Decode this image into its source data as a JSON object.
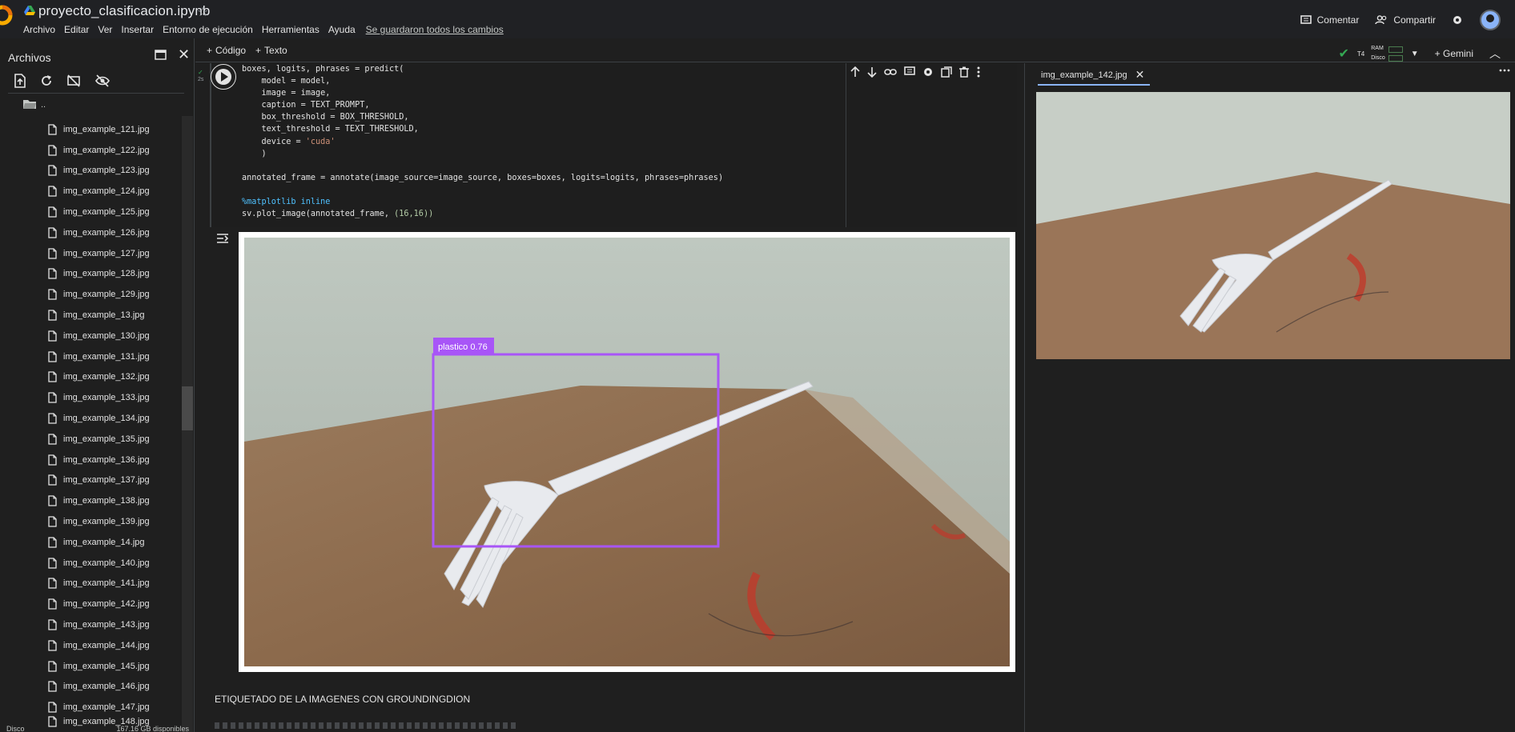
{
  "header": {
    "title": "proyecto_clasificacion.ipynb",
    "menu": [
      "Archivo",
      "Editar",
      "Ver",
      "Insertar",
      "Entorno de ejecución",
      "Herramientas",
      "Ayuda"
    ],
    "saved_status": "Se guardaron todos los cambios",
    "comment_label": "Comentar",
    "share_label": "Compartir"
  },
  "sidebar": {
    "title": "Archivos",
    "folder_label": "..",
    "files": [
      "img_example_121.jpg",
      "img_example_122.jpg",
      "img_example_123.jpg",
      "img_example_124.jpg",
      "img_example_125.jpg",
      "img_example_126.jpg",
      "img_example_127.jpg",
      "img_example_128.jpg",
      "img_example_129.jpg",
      "img_example_13.jpg",
      "img_example_130.jpg",
      "img_example_131.jpg",
      "img_example_132.jpg",
      "img_example_133.jpg",
      "img_example_134.jpg",
      "img_example_135.jpg",
      "img_example_136.jpg",
      "img_example_137.jpg",
      "img_example_138.jpg",
      "img_example_139.jpg",
      "img_example_14.jpg",
      "img_example_140.jpg",
      "img_example_141.jpg",
      "img_example_142.jpg",
      "img_example_143.jpg",
      "img_example_144.jpg",
      "img_example_145.jpg",
      "img_example_146.jpg",
      "img_example_147.jpg",
      "img_example_148.jpg"
    ],
    "footer_left": "Disco",
    "footer_right": "167.16 GB disponibles"
  },
  "toolbar": {
    "add_code": "Código",
    "add_text": "Texto",
    "runtime": "T4",
    "ram_label": "RAM",
    "disk_label": "Disco",
    "gemini_label": "Gemini"
  },
  "cell": {
    "status_time": "2s",
    "code_lines": [
      "boxes, logits, phrases = predict(",
      "    model = model,",
      "    image = image,",
      "    caption = TEXT_PROMPT,",
      "    box_threshold = BOX_THRESHOLD,",
      "    text_threshold = TEXT_THRESHOLD,",
      "    device = 'cuda'",
      "    )",
      "",
      "annotated_frame = annotate(image_source=image_source, boxes=boxes, logits=logits, phrases=phrases)",
      "",
      "%matplotlib inline",
      "sv.plot_image(annotated_frame, (16,16))"
    ],
    "detection_label": "plastico  0.76"
  },
  "markdown": {
    "heading": "ETIQUETADO DE LA IMAGENES CON GROUNDINGDION"
  },
  "right_panel": {
    "tab_label": "img_example_142.jpg"
  },
  "colors": {
    "background": "#1f1f1f",
    "accent": "#8ab4f8",
    "success": "#34a853",
    "bbox": "#a855f7"
  }
}
